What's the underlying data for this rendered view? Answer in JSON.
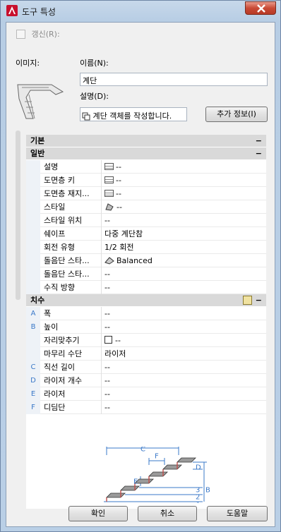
{
  "window": {
    "title": "도구 특성",
    "close_label": "X"
  },
  "refresh": {
    "label": "갱신(R):"
  },
  "image_label": "이미지:",
  "name": {
    "label": "이름(N):",
    "value": "계단"
  },
  "description": {
    "label": "설명(D):",
    "value": "계단 객체를 작성합니다."
  },
  "more_info_button": "추가 정보(I)",
  "sections": {
    "basic": "기본",
    "general": "일반",
    "dimensions": "치수",
    "collapse_symbol": "−"
  },
  "general_rows": [
    {
      "name": "설명",
      "value": "--",
      "icon": "table-icon"
    },
    {
      "name": "도면층 키",
      "value": "--",
      "icon": "table-icon"
    },
    {
      "name": "도면층 재지...",
      "value": "--",
      "icon": "table-icon"
    },
    {
      "name": "스타일",
      "value": "--",
      "icon": "stair-style-icon"
    },
    {
      "name": "스타일 위치",
      "value": "--"
    },
    {
      "name": "쉐이프",
      "value": "다중 계단참"
    },
    {
      "name": "회전 유형",
      "value": "1/2 회전"
    },
    {
      "name": "돌음단 스타...",
      "value": "Balanced",
      "icon": "winder-icon"
    },
    {
      "name": "돌음단 스타...",
      "value": "--"
    },
    {
      "name": "수직 방향",
      "value": "--"
    }
  ],
  "dimension_rows": [
    {
      "key": "A",
      "name": "폭",
      "value": "--"
    },
    {
      "key": "B",
      "name": "높이",
      "value": "--"
    },
    {
      "key": "",
      "name": "자리맞추기",
      "value": "--",
      "icon": "checkbox"
    },
    {
      "key": "",
      "name": "마무리 수단",
      "value": "라이저"
    },
    {
      "key": "C",
      "name": "직선 길이",
      "value": "--"
    },
    {
      "key": "D",
      "name": "라이저 개수",
      "value": "--"
    },
    {
      "key": "E",
      "name": "라이저",
      "value": "--"
    },
    {
      "key": "F",
      "name": "디딤단",
      "value": "--"
    }
  ],
  "diagram_labels": {
    "c": "C",
    "f": "F",
    "d": "D",
    "e": "E",
    "b": "B",
    "n3": "3",
    "n2": "2",
    "n1": "1"
  },
  "buttons": {
    "ok": "확인",
    "cancel": "취소",
    "help": "도움말"
  },
  "colors": {
    "accent": "#3a78c8",
    "close": "#c94a36",
    "app_icon": "#c8102e"
  }
}
